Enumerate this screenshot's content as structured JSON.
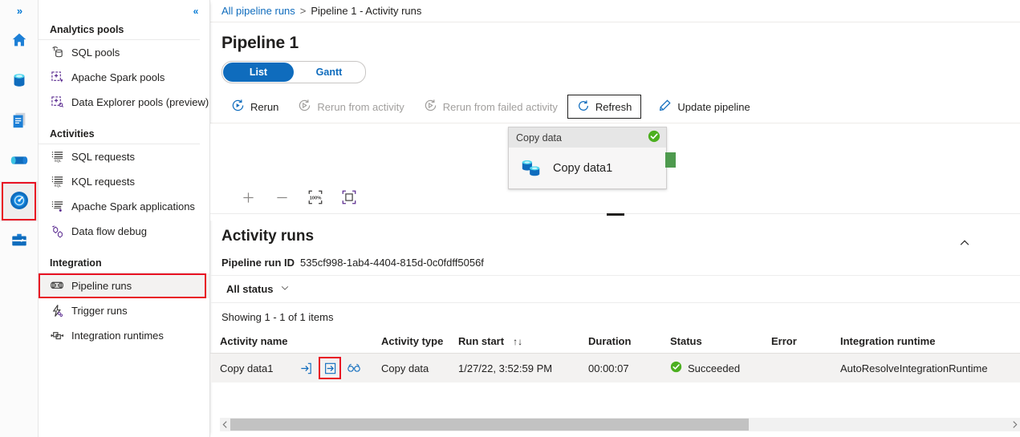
{
  "rail": {
    "expand_label": "»",
    "items": [
      {
        "name": "home",
        "title": "Home"
      },
      {
        "name": "data",
        "title": "Data"
      },
      {
        "name": "develop",
        "title": "Develop"
      },
      {
        "name": "integrate",
        "title": "Integrate"
      },
      {
        "name": "monitor",
        "title": "Monitor",
        "selected": true
      },
      {
        "name": "manage",
        "title": "Manage"
      }
    ]
  },
  "sidebar": {
    "collapse_label": "«",
    "groups": [
      {
        "title": "Analytics pools",
        "items": [
          {
            "label": "SQL pools",
            "icon": "sql-pools-icon"
          },
          {
            "label": "Apache Spark pools",
            "icon": "spark-pools-icon"
          },
          {
            "label": "Data Explorer pools (preview)",
            "icon": "data-explorer-pools-icon"
          }
        ]
      },
      {
        "title": "Activities",
        "items": [
          {
            "label": "SQL requests",
            "icon": "sql-requests-icon"
          },
          {
            "label": "KQL requests",
            "icon": "kql-requests-icon"
          },
          {
            "label": "Apache Spark applications",
            "icon": "spark-applications-icon"
          },
          {
            "label": "Data flow debug",
            "icon": "data-flow-debug-icon"
          }
        ]
      },
      {
        "title": "Integration",
        "items": [
          {
            "label": "Pipeline runs",
            "icon": "pipeline-runs-icon",
            "active": true,
            "highlighted": true
          },
          {
            "label": "Trigger runs",
            "icon": "trigger-runs-icon"
          },
          {
            "label": "Integration runtimes",
            "icon": "integration-runtimes-icon"
          }
        ]
      }
    ]
  },
  "breadcrumb": {
    "root": "All pipeline runs",
    "separator": ">",
    "current": "Pipeline 1 - Activity runs"
  },
  "page": {
    "title": "Pipeline 1"
  },
  "pivot": {
    "list": "List",
    "gantt": "Gantt",
    "selected": "List"
  },
  "toolbar": {
    "rerun": "Rerun",
    "rerun_from_activity": "Rerun from activity",
    "rerun_from_failed_activity": "Rerun from failed activity",
    "refresh": "Refresh",
    "update_pipeline": "Update pipeline"
  },
  "canvas": {
    "node": {
      "header": "Copy data",
      "title": "Copy data1",
      "status": "succeeded"
    },
    "tools": {
      "zoom_in": "+",
      "zoom_out": "−",
      "zoom_level": "100%",
      "fit_to_screen": "fit-to-screen"
    }
  },
  "activity_runs": {
    "title": "Activity runs",
    "run_id_label": "Pipeline run ID",
    "run_id_value": "535cf998-1ab4-4404-815d-0c0fdff5056f",
    "status_filter": "All status",
    "showing": "Showing 1 - 1 of 1 items",
    "columns": [
      "Activity name",
      "Activity type",
      "Run start",
      "Duration",
      "Status",
      "Error",
      "Integration runtime"
    ],
    "sort_indicator": "↑↓",
    "rows": [
      {
        "activity_name": "Copy data1",
        "activity_type": "Copy data",
        "run_start": "1/27/22, 3:52:59 PM",
        "duration": "00:00:07",
        "status": "Succeeded",
        "error": "",
        "integration_runtime": "AutoResolveIntegrationRuntime",
        "actions": [
          "input-icon",
          "output-icon",
          "details-icon"
        ]
      }
    ]
  },
  "colors": {
    "accent": "#0f6cbd",
    "success": "#4caf20",
    "highlight": "#e81123",
    "connector": "#4e9a4e"
  }
}
